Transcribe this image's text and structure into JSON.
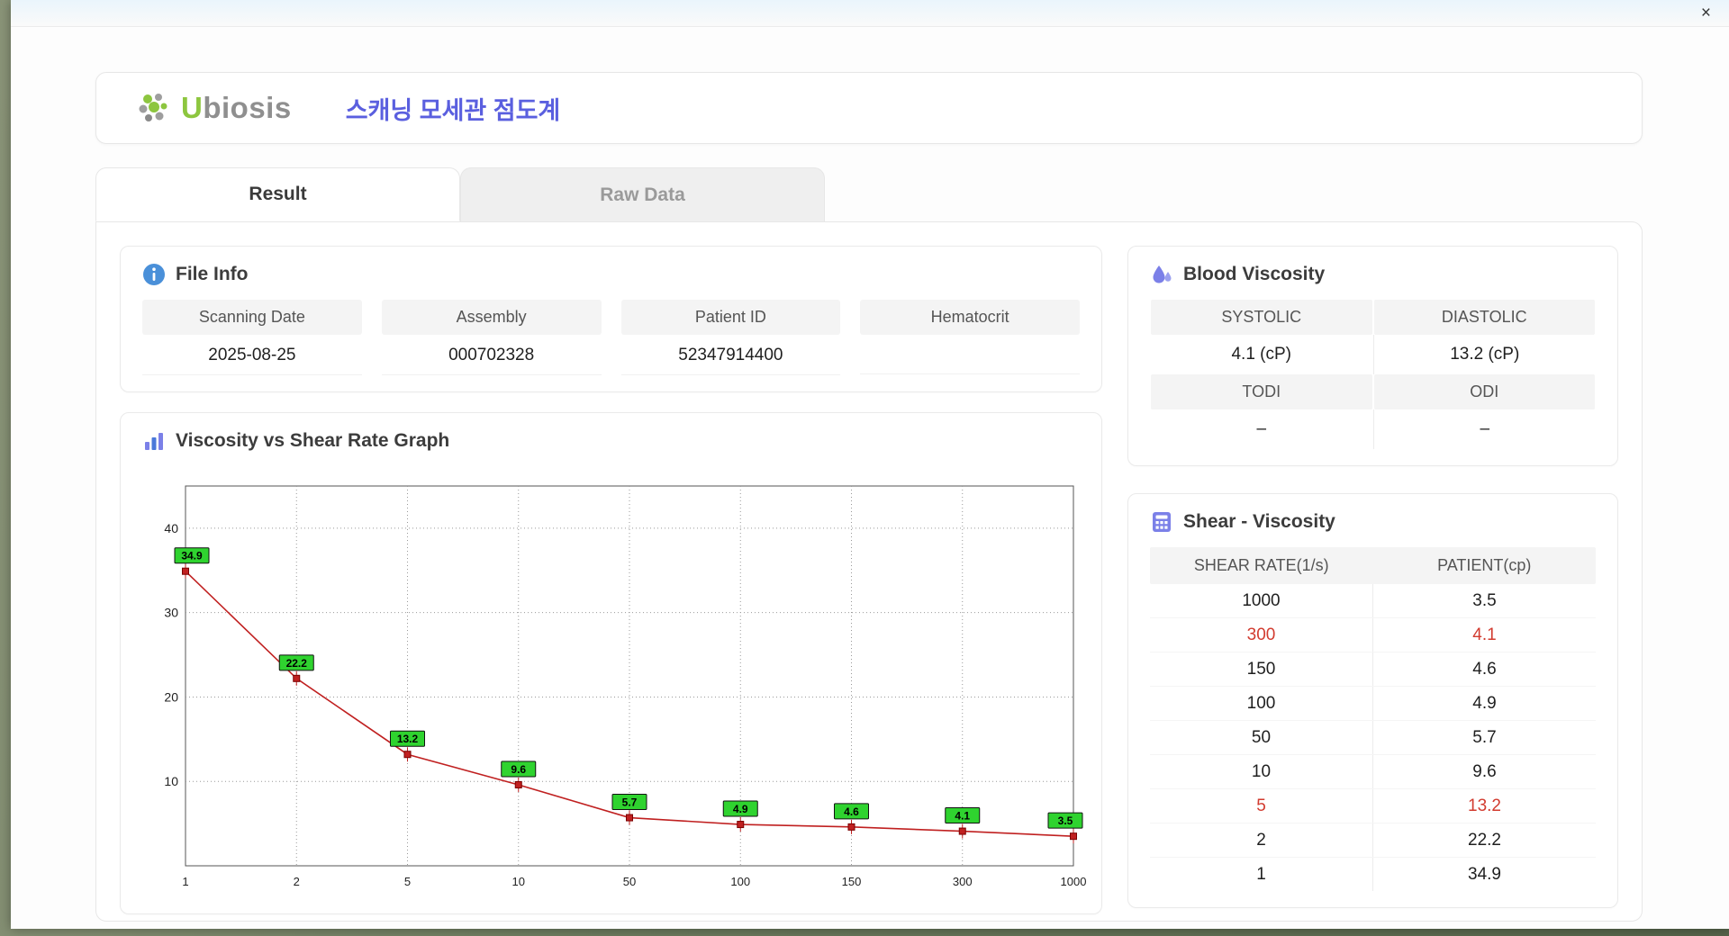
{
  "window": {
    "close_label": "×"
  },
  "icons": {
    "close": "close-icon",
    "logo": "ubiosis-leaf-icon",
    "file_info": "info-icon",
    "graph": "bar-chart-icon",
    "blood": "water-drop-icon",
    "shear": "calculator-icon"
  },
  "header": {
    "logo_prefix": "U",
    "logo_rest": "biosis",
    "title": "스캐닝 모세관 점도계"
  },
  "tabs": [
    {
      "label": "Result",
      "active": true
    },
    {
      "label": "Raw Data",
      "active": false
    }
  ],
  "file_info": {
    "title": "File Info",
    "fields": [
      {
        "label": "Scanning Date",
        "value": "2025-08-25"
      },
      {
        "label": "Assembly",
        "value": "000702328"
      },
      {
        "label": "Patient ID",
        "value": "52347914400"
      },
      {
        "label": "Hematocrit",
        "value": ""
      }
    ]
  },
  "graph": {
    "title": "Viscosity vs Shear Rate Graph"
  },
  "chart_data": {
    "type": "line",
    "title": "Viscosity vs Shear Rate Graph",
    "x": [
      1,
      2,
      5,
      10,
      50,
      100,
      150,
      300,
      1000
    ],
    "x_ticks": [
      "1",
      "2",
      "5",
      "10",
      "50",
      "100",
      "150",
      "300",
      "1000"
    ],
    "values": [
      34.9,
      22.2,
      13.2,
      9.6,
      5.7,
      4.9,
      4.6,
      4.1,
      3.5
    ],
    "labels": [
      "34.9",
      "22.2",
      "13.2",
      "9.6",
      "5.7",
      "4.9",
      "4.6",
      "4.1",
      "3.5"
    ],
    "y_ticks": [
      10,
      20,
      30,
      40
    ],
    "ylim": [
      0,
      45
    ],
    "x_scale": "categorical-log-ticks",
    "grid": "dotted",
    "line_color": "#c02020",
    "marker_color": "#c02020",
    "label_bg": "#2fd32f",
    "xlabel": "",
    "ylabel": ""
  },
  "blood_viscosity": {
    "title": "Blood Viscosity",
    "row1": {
      "h1": "SYSTOLIC",
      "h2": "DIASTOLIC",
      "v1": "4.1 (cP)",
      "v2": "13.2 (cP)"
    },
    "row2": {
      "h1": "TODI",
      "h2": "ODI",
      "v1": "–",
      "v2": "–"
    }
  },
  "shear_viscosity": {
    "title": "Shear - Viscosity",
    "headers": [
      "SHEAR RATE(1/s)",
      "PATIENT(cp)"
    ],
    "rows": [
      {
        "shear": "1000",
        "patient": "3.5",
        "highlight": false
      },
      {
        "shear": "300",
        "patient": "4.1",
        "highlight": true
      },
      {
        "shear": "150",
        "patient": "4.6",
        "highlight": false
      },
      {
        "shear": "100",
        "patient": "4.9",
        "highlight": false
      },
      {
        "shear": "50",
        "patient": "5.7",
        "highlight": false
      },
      {
        "shear": "10",
        "patient": "9.6",
        "highlight": false
      },
      {
        "shear": "5",
        "patient": "13.2",
        "highlight": true
      },
      {
        "shear": "2",
        "patient": "22.2",
        "highlight": false
      },
      {
        "shear": "1",
        "patient": "34.9",
        "highlight": false
      }
    ]
  }
}
